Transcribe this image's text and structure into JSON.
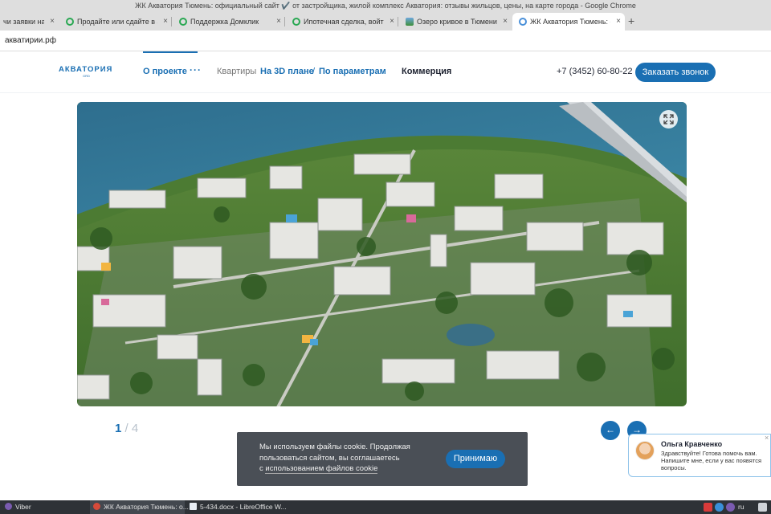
{
  "window": {
    "title": "ЖК Акватория Тюмень: официальный сайт ✔️ от застройщика, жилой комплекс Акватория: отзывы жильцов, цены, на карте города - Google Chrome"
  },
  "tabs": [
    {
      "label": "чи заявки на к",
      "icon": "green-ring-icon"
    },
    {
      "label": "Продайте или сдайте в ар",
      "icon": "domclick-icon"
    },
    {
      "label": "Поддержка Домклик",
      "icon": "domclick-icon"
    },
    {
      "label": "Ипотечная сделка, войти с",
      "icon": "domclick-icon"
    },
    {
      "label": "Озеро кривое в Тюмени на",
      "icon": "lake-icon"
    },
    {
      "label": "ЖК Акватория Тюмень: оф",
      "icon": "site-icon",
      "active": true
    }
  ],
  "new_tab": "+",
  "close_glyph": "×",
  "address": {
    "url": "акватирии.рф"
  },
  "site": {
    "logo": "АКВАТОРИЯ",
    "logo_sub": "GRD",
    "nav": {
      "about": "О проекте",
      "more": "···",
      "flats": "Квартиры",
      "plan_3d": "На 3D плане",
      "slash": "/",
      "params": "По параметрам",
      "commerce": "Коммерция"
    },
    "phone": "+7 (3452) 60-80-22",
    "call_button": "Заказать звонок"
  },
  "slider": {
    "current": "1",
    "total": "/ 4",
    "prev": "←",
    "next": "→",
    "fullscreen_icon": "expand-icon"
  },
  "cookie": {
    "text_line1": "Мы используем файлы cookie. Продолжая",
    "text_line2": "пользоваться сайтом, вы соглашаетесь",
    "text_line3_prefix": "с ",
    "text_link": "использованием файлов cookie",
    "accept": "Принимаю"
  },
  "chat": {
    "name": "Ольга Кравченко",
    "message": "Здравствуйте! Готова помочь вам. Напишите мне, если у вас появятся вопросы.",
    "close": "×"
  },
  "taskbar": {
    "viber": "Viber",
    "chrome": "ЖК Акватория Тюмень: о...",
    "doc": "5-434.docx - LibreOffice W...",
    "lang": "ru"
  },
  "colors": {
    "brand": "#1a6fb3",
    "cookie_bg": "#4a4f56",
    "taskbar": "#2e3237"
  }
}
